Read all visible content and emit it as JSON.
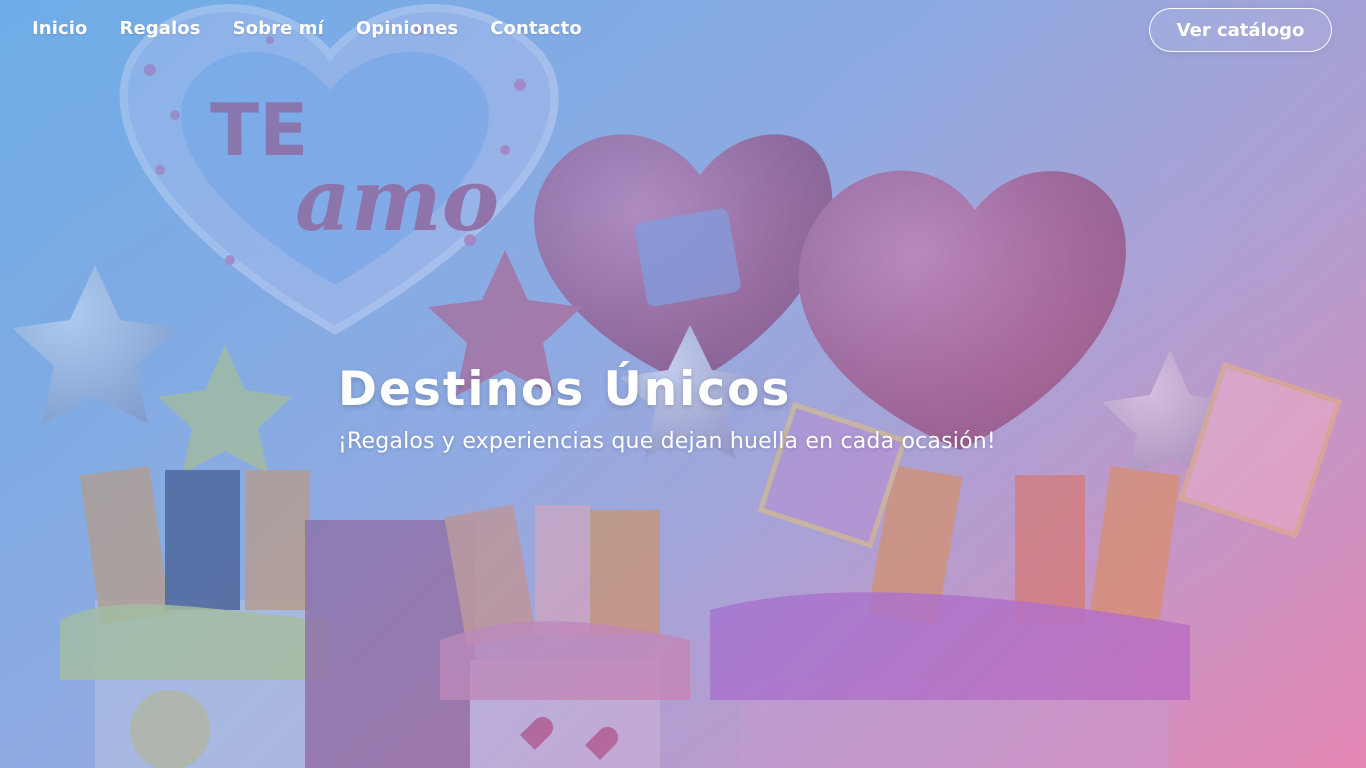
{
  "nav": {
    "items": [
      {
        "label": "Inicio"
      },
      {
        "label": "Regalos"
      },
      {
        "label": "Sobre mí"
      },
      {
        "label": "Opiniones"
      },
      {
        "label": "Contacto"
      }
    ],
    "cta_label": "Ver catálogo"
  },
  "hero": {
    "title": "Destinos Únicos",
    "subtitle": "¡Regalos y experiencias que dejan huella en cada ocasión!",
    "image_description_icons": [
      "heart-balloon-icon",
      "star-balloon-icon",
      "gift-basket-icon"
    ],
    "balloon_text": "TE amo"
  },
  "colors": {
    "overlay_blue": "#60A6E8",
    "overlay_pink": "#E678AA",
    "text": "#FFFFFF"
  }
}
